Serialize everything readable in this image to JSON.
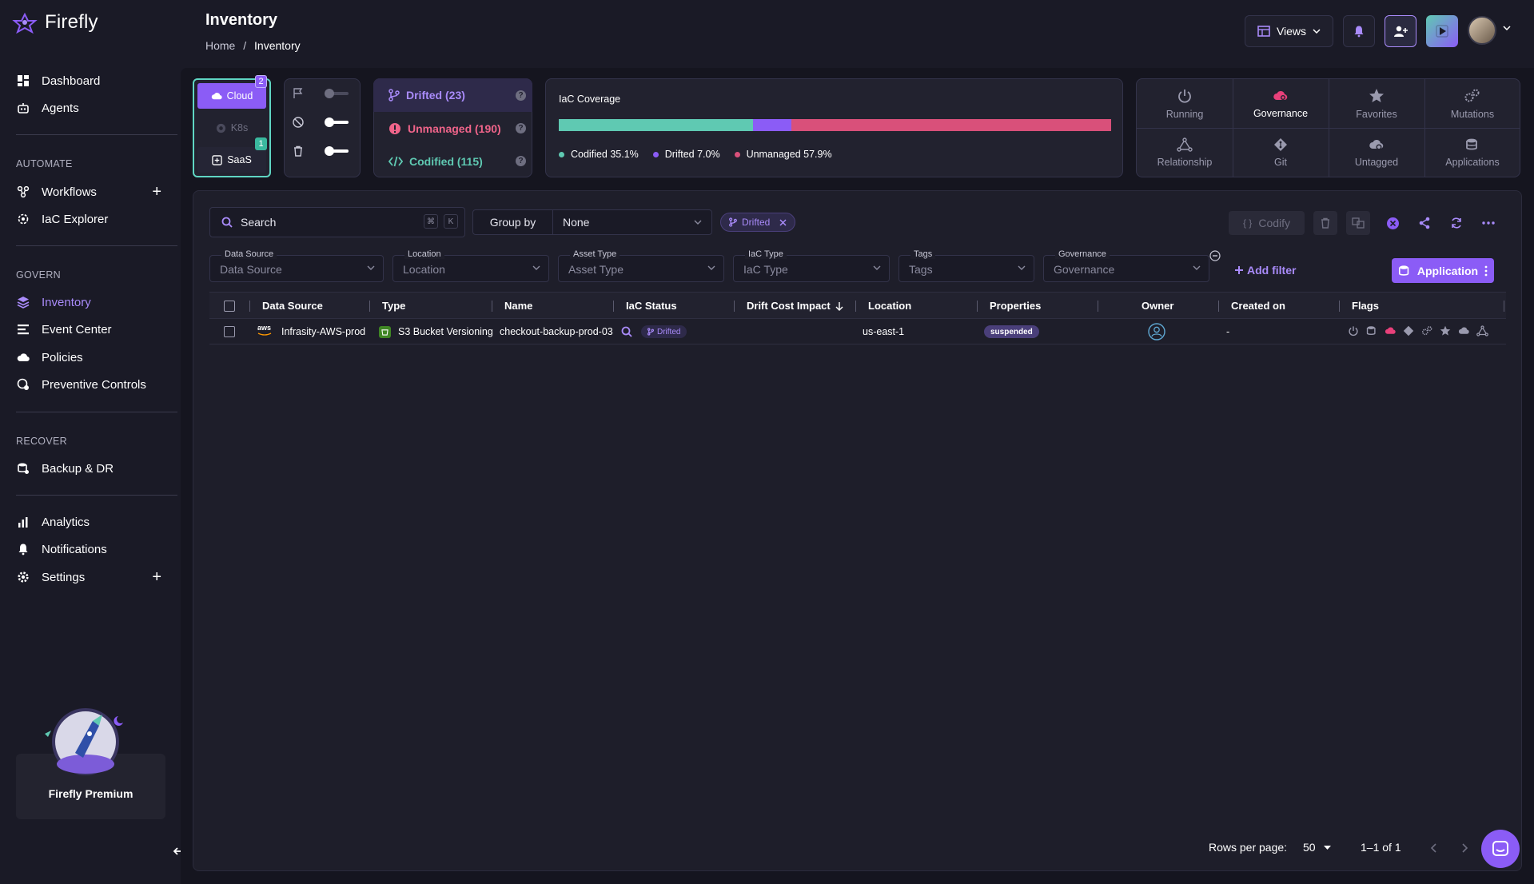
{
  "app": {
    "name": "Firefly"
  },
  "nav": {
    "dashboard": "Dashboard",
    "agents": "Agents",
    "automate_label": "AUTOMATE",
    "workflows": "Workflows",
    "iac_explorer": "IaC Explorer",
    "govern_label": "GOVERN",
    "inventory": "Inventory",
    "event_center": "Event Center",
    "policies": "Policies",
    "preventive_controls": "Preventive Controls",
    "recover_label": "RECOVER",
    "backup_dr": "Backup & DR",
    "analytics": "Analytics",
    "notifications": "Notifications",
    "settings": "Settings",
    "plus": "+"
  },
  "premium": {
    "label": "Firefly Premium"
  },
  "header": {
    "title": "Inventory",
    "breadcrumb_home": "Home",
    "breadcrumb_sep": "/",
    "breadcrumb_current": "Inventory",
    "views_label": "Views"
  },
  "data_sources": {
    "cloud": "Cloud",
    "cloud_count": "2",
    "k8s": "K8s",
    "saas": "SaaS",
    "saas_count": "1"
  },
  "iac_status": {
    "drifted": "Drifted  (23)",
    "unmanaged": "Unmanaged  (190)",
    "codified": "Codified  (115)"
  },
  "coverage": {
    "title": "IaC Coverage",
    "codified_pct": 35.1,
    "drifted_pct": 7.0,
    "unmanaged_pct": 57.9,
    "codified_label": "Codified 35.1%",
    "drifted_label": "Drifted 7.0%",
    "unmanaged_label": "Unmanaged 57.9%",
    "colors": {
      "codified": "#5fc9b2",
      "drifted": "#8b5cf6",
      "unmanaged": "#d9507a"
    }
  },
  "quick_filters": {
    "running": "Running",
    "governance": "Governance",
    "favorites": "Favorites",
    "mutations": "Mutations",
    "relationship": "Relationship",
    "git": "Git",
    "untagged": "Untagged",
    "applications": "Applications"
  },
  "toolbar": {
    "search_placeholder": "Search",
    "kbd_cmd": "⌘",
    "kbd_k": "K",
    "group_by_label": "Group by",
    "group_by_value": "None",
    "active_chip": "Drifted",
    "codify_label": "Codify",
    "codify_braces": "{ }"
  },
  "filters": {
    "data_source_label": "Data Source",
    "data_source_placeholder": "Data Source",
    "location_label": "Location",
    "location_placeholder": "Location",
    "asset_type_label": "Asset Type",
    "asset_type_placeholder": "Asset Type",
    "iac_type_label": "IaC Type",
    "iac_type_placeholder": "IaC Type",
    "tags_label": "Tags",
    "tags_placeholder": "Tags",
    "governance_label": "Governance",
    "governance_placeholder": "Governance",
    "add_filter": "Add filter",
    "application_button": "Application"
  },
  "table": {
    "columns": [
      "Data Source",
      "Type",
      "Name",
      "IaC Status",
      "Drift Cost Impact",
      "Location",
      "Properties",
      "Owner",
      "Created on",
      "Flags"
    ],
    "rows": [
      {
        "data_source_logo": "aws",
        "data_source": "Infrasity-AWS-prod",
        "type": "S3 Bucket Versioning",
        "name": "checkout-backup-prod-03",
        "iac_status": "Drifted",
        "drift_cost_impact": "",
        "location": "us-east-1",
        "properties": "suspended",
        "created_on": "-"
      }
    ]
  },
  "pagination": {
    "rows_per_page_label": "Rows per page:",
    "rows_per_page": "50",
    "range": "1–1 of 1"
  }
}
